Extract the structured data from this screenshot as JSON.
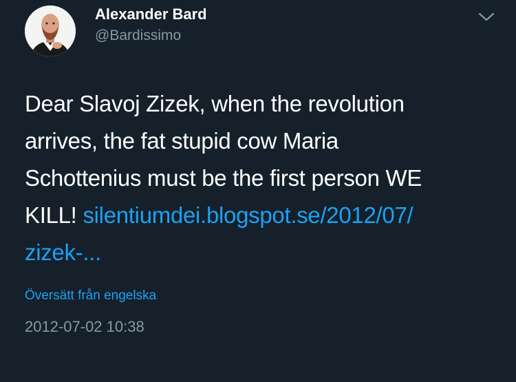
{
  "author": {
    "name": "Alexander Bard",
    "handle": "@Bardissimo",
    "avatar_icon": "profile-photo"
  },
  "menu_icon": "chevron-down-icon",
  "tweet": {
    "text_lines": [
      "Dear Slavoj Zizek, when the revolution",
      "arrives, the fat stupid cow Maria",
      "Schottenius must be the first person WE",
      "KILL!"
    ],
    "link_part1": "silentiumdei.blogspot.se/2012/07/",
    "link_part2": "zizek-..."
  },
  "translate_label": "Översätt från engelska",
  "timestamp": "2012-07-02 10:38",
  "colors": {
    "background": "#15202b",
    "text": "#ffffff",
    "secondary": "#8899a6",
    "link": "#1da1f2"
  }
}
